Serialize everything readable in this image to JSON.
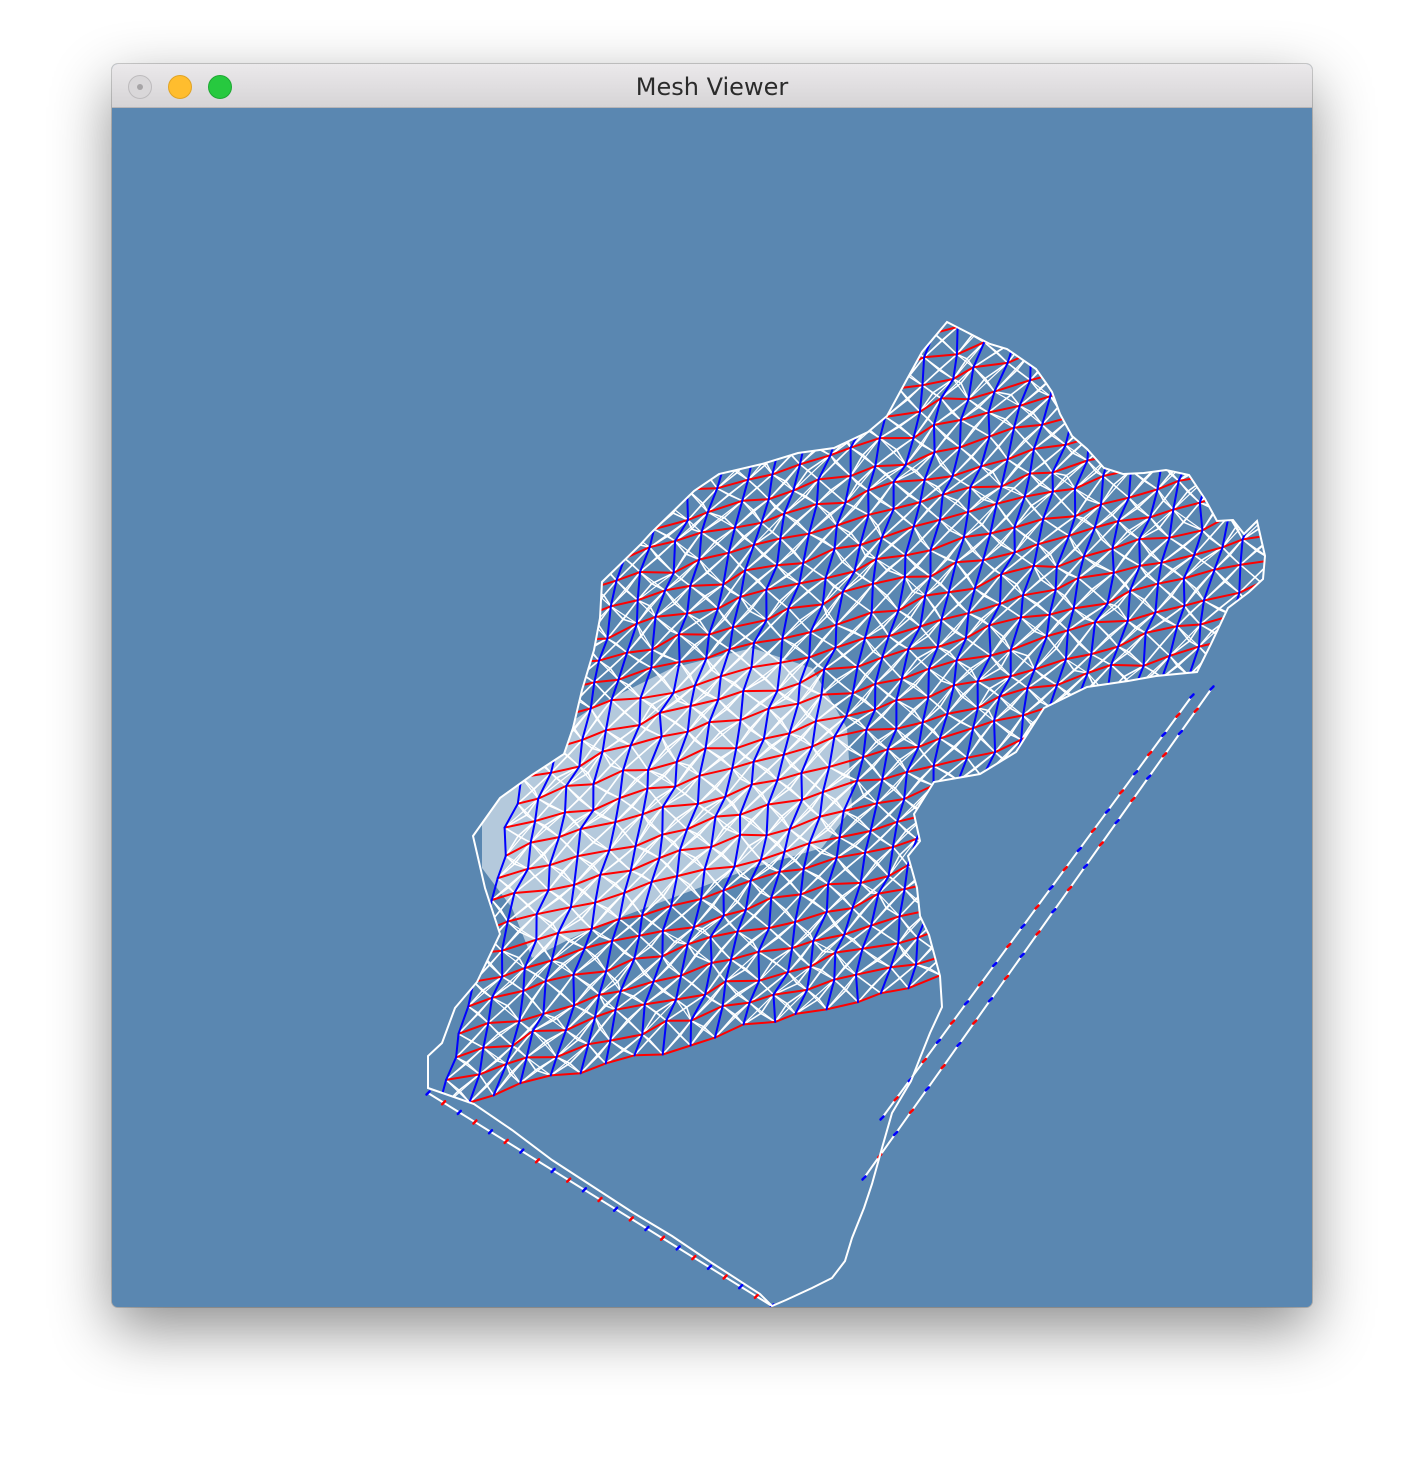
{
  "window": {
    "title": "Mesh Viewer"
  },
  "colors": {
    "background": "#5a87b1",
    "mesh_edge": "#ffffff",
    "row_edge": "#ff0000",
    "column_edge": "#0000ff"
  },
  "icons": {
    "close": "close-button-icon",
    "minimize": "minimize-button-icon",
    "zoom": "zoom-button-icon"
  }
}
